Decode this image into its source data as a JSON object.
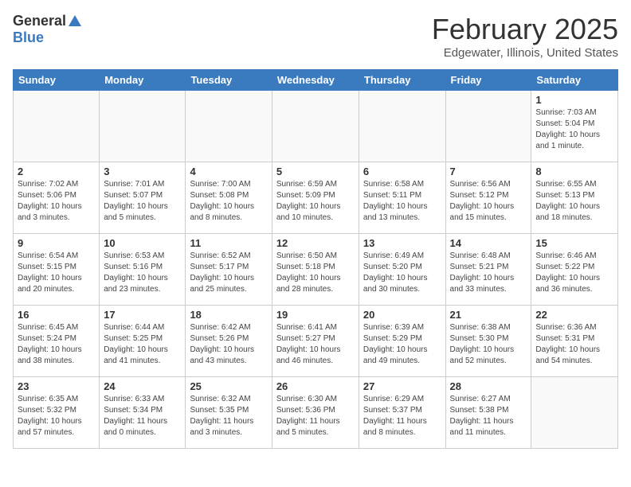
{
  "header": {
    "logo_general": "General",
    "logo_blue": "Blue",
    "month": "February 2025",
    "location": "Edgewater, Illinois, United States"
  },
  "weekdays": [
    "Sunday",
    "Monday",
    "Tuesday",
    "Wednesday",
    "Thursday",
    "Friday",
    "Saturday"
  ],
  "weeks": [
    [
      {
        "day": "",
        "info": ""
      },
      {
        "day": "",
        "info": ""
      },
      {
        "day": "",
        "info": ""
      },
      {
        "day": "",
        "info": ""
      },
      {
        "day": "",
        "info": ""
      },
      {
        "day": "",
        "info": ""
      },
      {
        "day": "1",
        "info": "Sunrise: 7:03 AM\nSunset: 5:04 PM\nDaylight: 10 hours\nand 1 minute."
      }
    ],
    [
      {
        "day": "2",
        "info": "Sunrise: 7:02 AM\nSunset: 5:06 PM\nDaylight: 10 hours\nand 3 minutes."
      },
      {
        "day": "3",
        "info": "Sunrise: 7:01 AM\nSunset: 5:07 PM\nDaylight: 10 hours\nand 5 minutes."
      },
      {
        "day": "4",
        "info": "Sunrise: 7:00 AM\nSunset: 5:08 PM\nDaylight: 10 hours\nand 8 minutes."
      },
      {
        "day": "5",
        "info": "Sunrise: 6:59 AM\nSunset: 5:09 PM\nDaylight: 10 hours\nand 10 minutes."
      },
      {
        "day": "6",
        "info": "Sunrise: 6:58 AM\nSunset: 5:11 PM\nDaylight: 10 hours\nand 13 minutes."
      },
      {
        "day": "7",
        "info": "Sunrise: 6:56 AM\nSunset: 5:12 PM\nDaylight: 10 hours\nand 15 minutes."
      },
      {
        "day": "8",
        "info": "Sunrise: 6:55 AM\nSunset: 5:13 PM\nDaylight: 10 hours\nand 18 minutes."
      }
    ],
    [
      {
        "day": "9",
        "info": "Sunrise: 6:54 AM\nSunset: 5:15 PM\nDaylight: 10 hours\nand 20 minutes."
      },
      {
        "day": "10",
        "info": "Sunrise: 6:53 AM\nSunset: 5:16 PM\nDaylight: 10 hours\nand 23 minutes."
      },
      {
        "day": "11",
        "info": "Sunrise: 6:52 AM\nSunset: 5:17 PM\nDaylight: 10 hours\nand 25 minutes."
      },
      {
        "day": "12",
        "info": "Sunrise: 6:50 AM\nSunset: 5:18 PM\nDaylight: 10 hours\nand 28 minutes."
      },
      {
        "day": "13",
        "info": "Sunrise: 6:49 AM\nSunset: 5:20 PM\nDaylight: 10 hours\nand 30 minutes."
      },
      {
        "day": "14",
        "info": "Sunrise: 6:48 AM\nSunset: 5:21 PM\nDaylight: 10 hours\nand 33 minutes."
      },
      {
        "day": "15",
        "info": "Sunrise: 6:46 AM\nSunset: 5:22 PM\nDaylight: 10 hours\nand 36 minutes."
      }
    ],
    [
      {
        "day": "16",
        "info": "Sunrise: 6:45 AM\nSunset: 5:24 PM\nDaylight: 10 hours\nand 38 minutes."
      },
      {
        "day": "17",
        "info": "Sunrise: 6:44 AM\nSunset: 5:25 PM\nDaylight: 10 hours\nand 41 minutes."
      },
      {
        "day": "18",
        "info": "Sunrise: 6:42 AM\nSunset: 5:26 PM\nDaylight: 10 hours\nand 43 minutes."
      },
      {
        "day": "19",
        "info": "Sunrise: 6:41 AM\nSunset: 5:27 PM\nDaylight: 10 hours\nand 46 minutes."
      },
      {
        "day": "20",
        "info": "Sunrise: 6:39 AM\nSunset: 5:29 PM\nDaylight: 10 hours\nand 49 minutes."
      },
      {
        "day": "21",
        "info": "Sunrise: 6:38 AM\nSunset: 5:30 PM\nDaylight: 10 hours\nand 52 minutes."
      },
      {
        "day": "22",
        "info": "Sunrise: 6:36 AM\nSunset: 5:31 PM\nDaylight: 10 hours\nand 54 minutes."
      }
    ],
    [
      {
        "day": "23",
        "info": "Sunrise: 6:35 AM\nSunset: 5:32 PM\nDaylight: 10 hours\nand 57 minutes."
      },
      {
        "day": "24",
        "info": "Sunrise: 6:33 AM\nSunset: 5:34 PM\nDaylight: 11 hours\nand 0 minutes."
      },
      {
        "day": "25",
        "info": "Sunrise: 6:32 AM\nSunset: 5:35 PM\nDaylight: 11 hours\nand 3 minutes."
      },
      {
        "day": "26",
        "info": "Sunrise: 6:30 AM\nSunset: 5:36 PM\nDaylight: 11 hours\nand 5 minutes."
      },
      {
        "day": "27",
        "info": "Sunrise: 6:29 AM\nSunset: 5:37 PM\nDaylight: 11 hours\nand 8 minutes."
      },
      {
        "day": "28",
        "info": "Sunrise: 6:27 AM\nSunset: 5:38 PM\nDaylight: 11 hours\nand 11 minutes."
      },
      {
        "day": "",
        "info": ""
      }
    ]
  ]
}
